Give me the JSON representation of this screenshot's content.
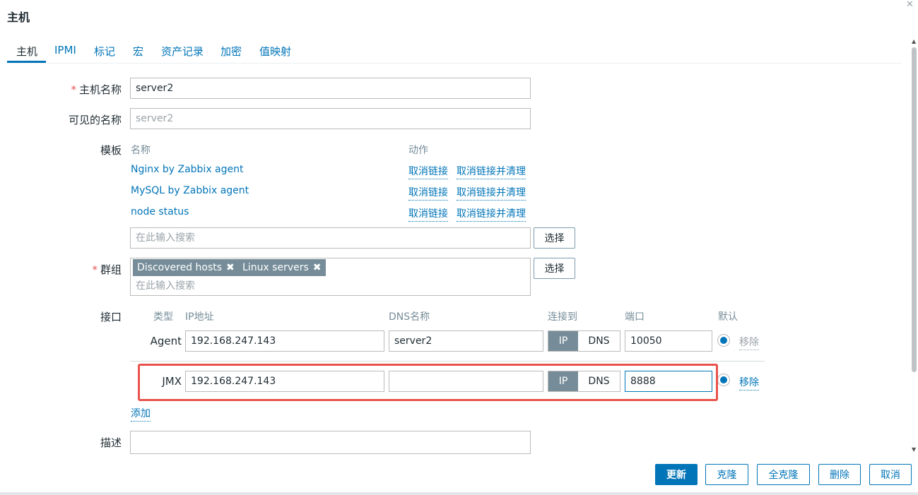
{
  "dialog": {
    "title": "主机",
    "close_glyph": "✕"
  },
  "tabs": [
    {
      "label": "主机",
      "active": true
    },
    {
      "label": "IPMI"
    },
    {
      "label": "标记"
    },
    {
      "label": "宏"
    },
    {
      "label": "资产记录"
    },
    {
      "label": "加密"
    },
    {
      "label": "值映射"
    }
  ],
  "form": {
    "required_mark": "*",
    "host_name": {
      "label": "主机名称",
      "value": "server2"
    },
    "visible_name": {
      "label": "可见的名称",
      "placeholder": "server2"
    },
    "templates": {
      "label": "模板",
      "col_name": "名称",
      "col_action": "动作",
      "rows": [
        {
          "name": "Nginx by Zabbix agent",
          "unlink": "取消链接",
          "unlink_clear": "取消链接并清理"
        },
        {
          "name": "MySQL by Zabbix agent",
          "unlink": "取消链接",
          "unlink_clear": "取消链接并清理"
        },
        {
          "name": "node status",
          "unlink": "取消链接",
          "unlink_clear": "取消链接并清理"
        }
      ],
      "search_placeholder": "在此输入搜索",
      "select_label": "选择"
    },
    "groups": {
      "label": "群组",
      "chips": [
        "Discovered hosts",
        "Linux servers"
      ],
      "chip_remove_glyph": "✖",
      "search_placeholder": "在此输入搜索",
      "select_label": "选择"
    },
    "interfaces": {
      "label": "接口",
      "col_type": "类型",
      "col_ip": "IP地址",
      "col_dns": "DNS名称",
      "col_connect": "连接到",
      "col_port": "端口",
      "col_default": "默认",
      "rows": [
        {
          "type": "Agent",
          "ip": "192.168.247.143",
          "dns": "server2",
          "ip_label": "IP",
          "dns_label": "DNS",
          "port": "10050",
          "remove": "移除"
        },
        {
          "type": "JMX",
          "ip": "192.168.247.143",
          "dns": "",
          "ip_label": "IP",
          "dns_label": "DNS",
          "port": "8888",
          "remove": "移除"
        }
      ],
      "add_label": "添加"
    },
    "description": {
      "label": "描述"
    }
  },
  "footer": {
    "update": "更新",
    "clone": "克隆",
    "full_clone": "全克隆",
    "delete": "删除",
    "cancel": "取消"
  },
  "colors": {
    "link": "#0275b8",
    "highlight_box": "#e8534e",
    "chip_bg": "#768d99",
    "required": "#e45959"
  }
}
